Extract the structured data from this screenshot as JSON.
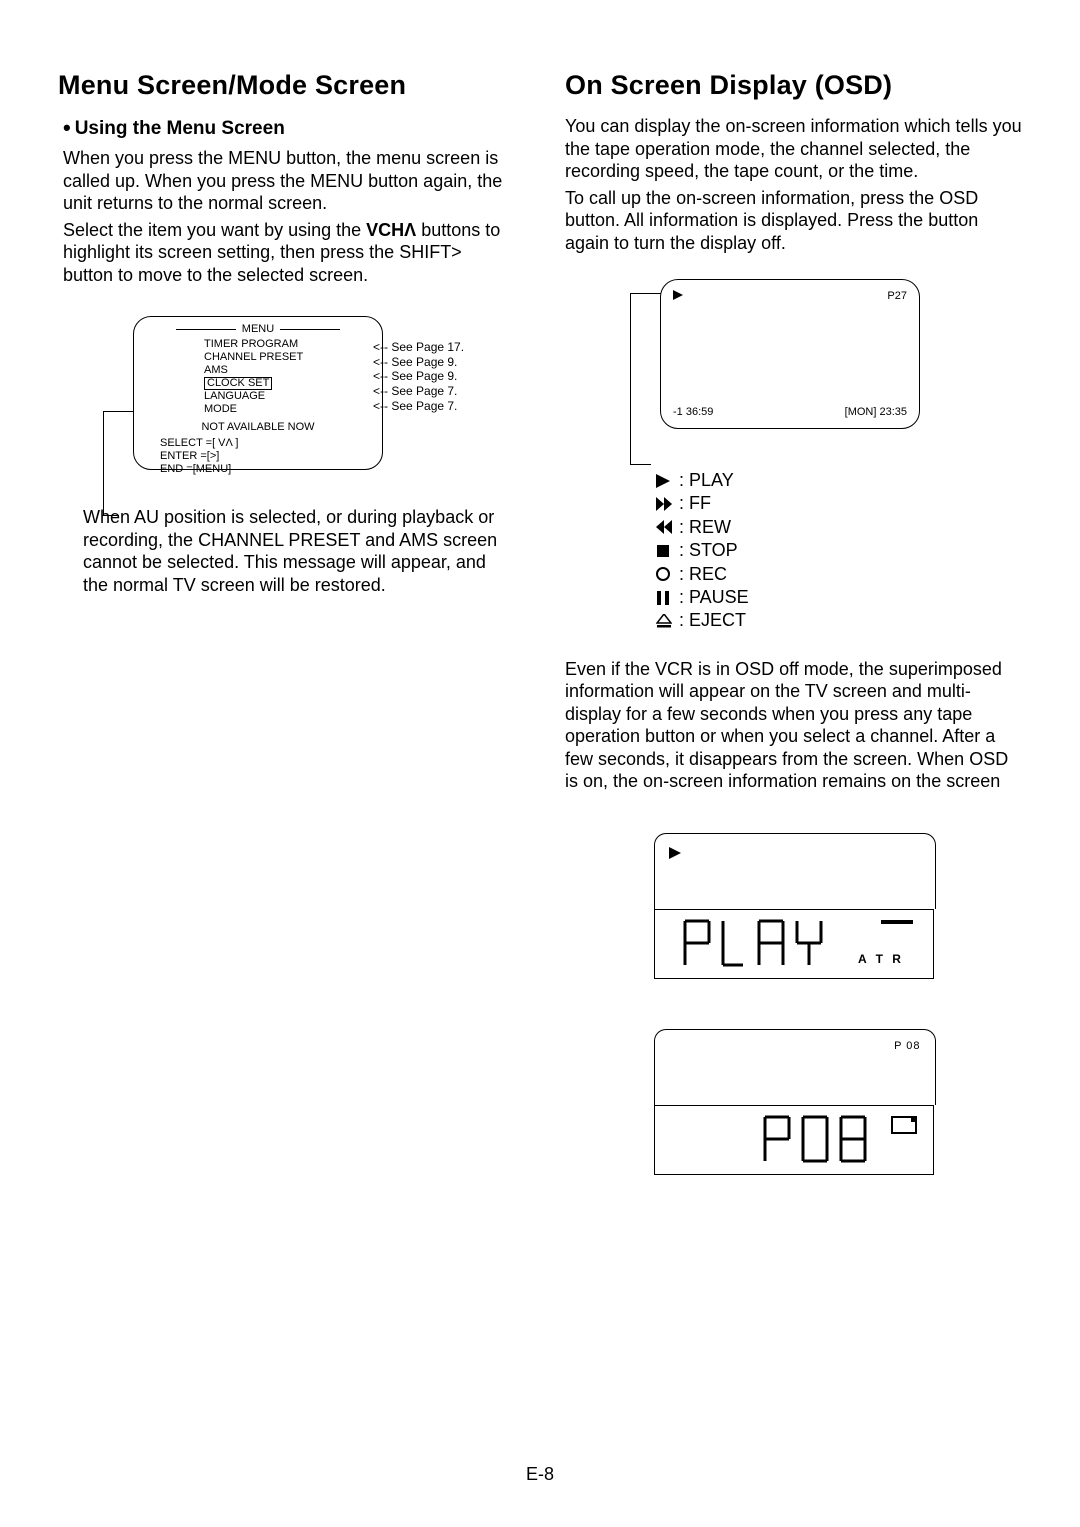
{
  "left": {
    "h1": "Menu Screen/Mode Screen",
    "h2_bullet": "•",
    "h2": "Using the Menu Screen",
    "p1a": "When you press the MENU button, the menu screen is called up. When you press the MENU button again, the unit returns to the normal screen.",
    "p1b_pre": "Select the item you want by using the ",
    "p1b_vch": "VCHΛ",
    "p1b_post": " buttons to highlight its screen setting, then press the SHIFT> button to move to the selected screen.",
    "menu": {
      "title": "MENU",
      "items": [
        "TIMER PROGRAM",
        "CHANNEL PRESET",
        "AMS",
        "CLOCK SET",
        "LANGUAGE",
        "MODE"
      ],
      "na": "NOT AVAILABLE NOW",
      "c_select": "SELECT =[ VΛ ]",
      "c_enter": "ENTER   =[>]",
      "c_end": "END       =[MENU]",
      "refs": [
        "<-- See Page 17.",
        "<-- See Page 9.",
        "<-- See Page 9.",
        "<-- See Page 7.",
        "<-- See Page 7."
      ]
    },
    "note": "When AU position is selected, or during playback or recording, the CHANNEL PRESET and AMS screen cannot be selected. This message will appear, and the normal TV screen will be restored."
  },
  "right": {
    "h1": "On Screen Display (OSD)",
    "p1": "You can display the on-screen information which tells you the tape operation mode, the channel selected, the recording speed, the tape count, or the time.",
    "p2": "To call up the on-screen information, press the OSD button. All information is displayed. Press the button again to turn the display off.",
    "tv": {
      "tr": "P27",
      "bl": "-1   36:59",
      "br": "[MON] 23:35"
    },
    "legend": {
      "play": ": PLAY",
      "ff": ": FF",
      "rew": ": REW",
      "stop": ": STOP",
      "rec": ": REC",
      "pause": ": PAUSE",
      "eject": ": EJECT"
    },
    "p3": "Even if the VCR is in OSD off mode, the superimposed information will appear on the TV screen and multi-display for a few seconds when you press any tape operation button or when you select a channel. After a few seconds, it disappears from the screen. When OSD is on, the on-screen information remains on the screen",
    "disp1": {
      "atr": "A T R"
    },
    "disp2": {
      "tr": "P 08"
    }
  },
  "page": "E-8"
}
